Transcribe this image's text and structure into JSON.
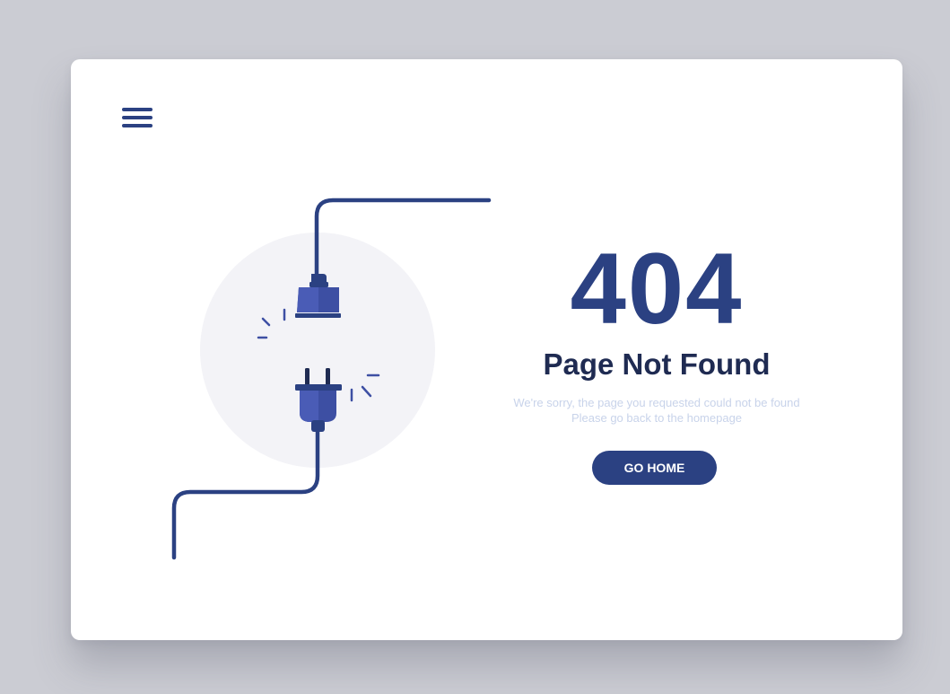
{
  "header": {
    "menu_icon": "hamburger-menu-icon"
  },
  "illustration": {
    "icons": [
      "unplugged-socket-icon",
      "unplugged-plug-icon",
      "spark-icon",
      "cable-icon"
    ]
  },
  "error": {
    "code": "404",
    "title": "Page Not Found",
    "message_line1": "We're sorry, the page you requested could not be found",
    "message_line2": "Please go back to the homepage"
  },
  "actions": {
    "go_home_label": "GO HOME"
  },
  "colors": {
    "background": "#cbccd3",
    "card": "#ffffff",
    "accent": "#2b4182",
    "plug": "#3d4fa3",
    "title": "#1f2b52",
    "muted_text": "#c8d3ea",
    "circle": "#f3f3f7"
  }
}
